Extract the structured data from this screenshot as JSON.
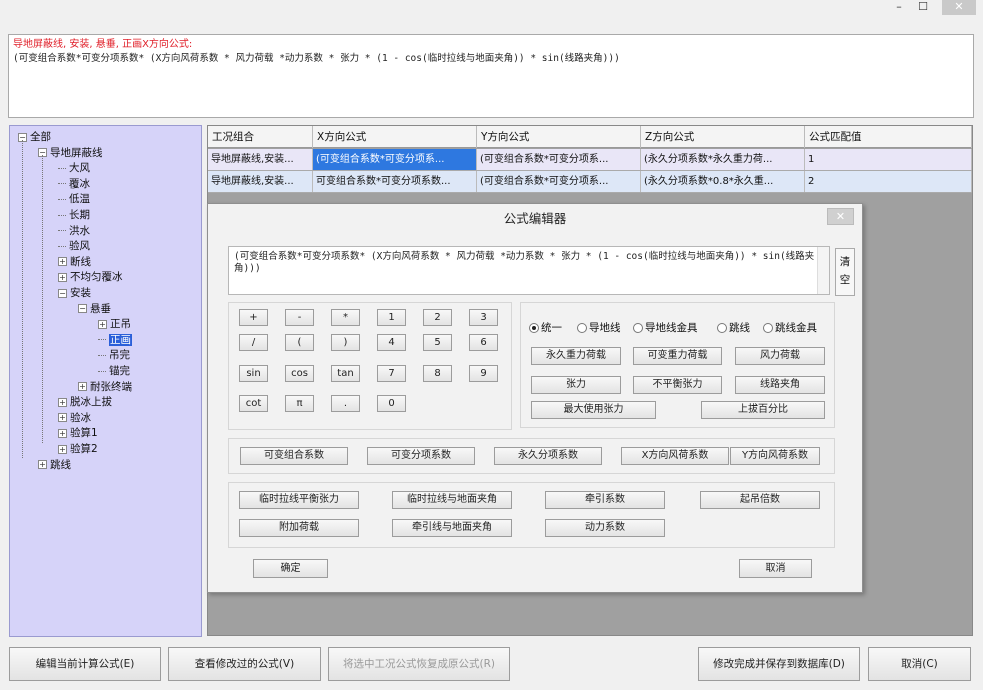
{
  "window": {
    "minimize": "–",
    "maximize": "☐",
    "close": "✕"
  },
  "formula_display": {
    "title_line": "导地屏蔽线, 安装, 悬垂, 正画X方向公式:",
    "formula_line": "(可变组合系数*可变分项系数* (X方向风荷系数 * 风力荷载 *动力系数 * 张力 * (1 - cos(临时拉线与地面夹角)) * sin(线路夹角)))"
  },
  "tree": {
    "items": [
      {
        "label": "全部",
        "exp": "−"
      },
      {
        "label": "导地屏蔽线",
        "exp": "−"
      },
      {
        "label": "大风",
        "exp": ""
      },
      {
        "label": "覆冰",
        "exp": ""
      },
      {
        "label": "低温",
        "exp": ""
      },
      {
        "label": "长期",
        "exp": ""
      },
      {
        "label": "洪水",
        "exp": ""
      },
      {
        "label": "验风",
        "exp": ""
      },
      {
        "label": "断线",
        "exp": "+"
      },
      {
        "label": "不均匀覆冰",
        "exp": "+"
      },
      {
        "label": "安装",
        "exp": "−"
      },
      {
        "label": "悬垂",
        "exp": "−"
      },
      {
        "label": "正吊",
        "exp": "+"
      },
      {
        "label": "正画",
        "exp": "",
        "selected": true
      },
      {
        "label": "吊完",
        "exp": ""
      },
      {
        "label": "锚完",
        "exp": ""
      },
      {
        "label": "耐张终端",
        "exp": "+"
      },
      {
        "label": "脱冰上拔",
        "exp": "+"
      },
      {
        "label": "验冰",
        "exp": "+"
      },
      {
        "label": "验算1",
        "exp": "+"
      },
      {
        "label": "验算2",
        "exp": "+"
      },
      {
        "label": "跳线",
        "exp": "+"
      }
    ]
  },
  "grid": {
    "headers": [
      "工况组合",
      "X方向公式",
      "Y方向公式",
      "Z方向公式",
      "公式匹配值"
    ],
    "rows": [
      [
        "导地屏蔽线,安装...",
        "(可变组合系数*可变分项系...",
        "(可变组合系数*可变分项系...",
        "(永久分项系数*永久重力荷...",
        "1"
      ],
      [
        "导地屏蔽线,安装...",
        "可变组合系数*可变分项系数...",
        "(可变组合系数*可变分项系...",
        "(永久分项系数*0.8*永久重...",
        "2"
      ]
    ]
  },
  "dialog": {
    "title": "公式编辑器",
    "close": "✕",
    "formula_text": "(可变组合系数*可变分项系数* (X方向风荷系数 * 风力荷载 *动力系数 * 张力 * (1 - cos(临时拉线与地面夹角)) * sin(线路夹角)))",
    "clear_label": "清空",
    "keypad": {
      "row1": [
        "+",
        "-",
        "*",
        "1",
        "2",
        "3"
      ],
      "row2": [
        "/",
        "(",
        ")",
        "4",
        "5",
        "6"
      ],
      "row3": [
        "sin",
        "cos",
        "tan",
        "7",
        "8",
        "9"
      ],
      "row4": [
        "cot",
        "π",
        ".",
        "0"
      ]
    },
    "radios": [
      "统一",
      "导地线",
      "导地线金具",
      "跳线",
      "跳线金具"
    ],
    "load_buttons": [
      "永久重力荷载",
      "可变重力荷载",
      "风力荷载",
      "张力",
      "不平衡张力",
      "线路夹角",
      "最大使用张力",
      "上拔百分比"
    ],
    "coef_buttons": [
      "可变组合系数",
      "可变分项系数",
      "永久分项系数",
      "X方向风荷系数",
      "Y方向风荷系数"
    ],
    "misc_buttons": [
      "临时拉线平衡张力",
      "临时拉线与地面夹角",
      "牵引系数",
      "起吊倍数",
      "附加荷载",
      "牵引线与地面夹角",
      "动力系数"
    ],
    "ok_label": "确定",
    "cancel_label": "取消"
  },
  "bottom": {
    "edit_current": "编辑当前计算公式(E)",
    "view_modified": "查看修改过的公式(V)",
    "restore_original": "将选中工况公式恢复成原公式(R)",
    "save_db": "修改完成并保存到数据库(D)",
    "cancel": "取消(C)"
  }
}
